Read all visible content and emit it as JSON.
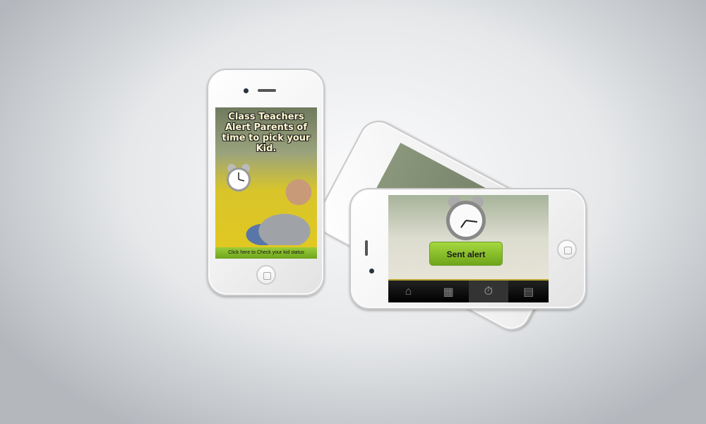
{
  "promo_phone": {
    "headline": "Class Teachers Alert Parents of time to pick your Kid.",
    "cta": "Click here to Check your  kid status"
  },
  "alert_phone": {
    "button": "Sent alert",
    "tabs": [
      {
        "icon": "home-icon",
        "glyph": "⌂"
      },
      {
        "icon": "calendar-grid-icon",
        "glyph": "▦"
      },
      {
        "icon": "stopwatch-icon",
        "glyph": "⏱"
      },
      {
        "icon": "film-icon",
        "glyph": "▤"
      }
    ],
    "active_tab": 2
  }
}
